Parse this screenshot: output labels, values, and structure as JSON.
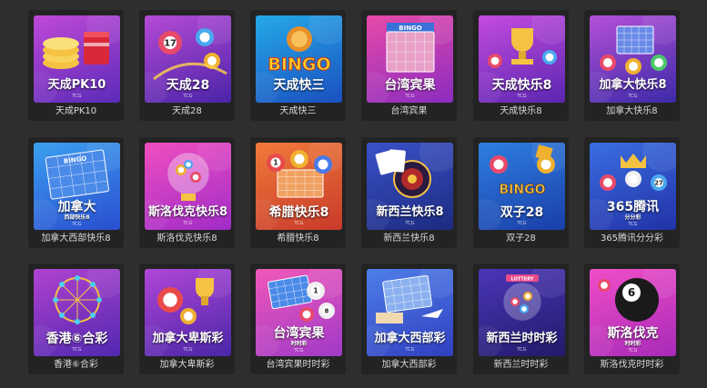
{
  "games": [
    {
      "label": "天成PK10",
      "thumb_title": "天成PK10",
      "thumb_sub": "",
      "thumb_tcg": "TCG",
      "bg_top": "#c048d8",
      "bg_bottom": "#5a2bb8",
      "art": "chips-coins-icon"
    },
    {
      "label": "天成28",
      "thumb_title": "天成28",
      "thumb_sub": "",
      "thumb_tcg": "TCG",
      "bg_top": "#b54ad6",
      "bg_bottom": "#4a24a8",
      "art": "lottery-balls-icon"
    },
    {
      "label": "天成快三",
      "thumb_title": "天成快三",
      "thumb_sub": "",
      "thumb_tcg": "",
      "bg_top": "#25a9e8",
      "bg_bottom": "#1a4fbf",
      "art": "bingo-lion-icon"
    },
    {
      "label": "台湾宾果",
      "thumb_title": "台湾宾果",
      "thumb_sub": "",
      "thumb_tcg": "TCG",
      "bg_top": "#e84aa8",
      "bg_bottom": "#8a2cc0",
      "art": "bingo-card-icon"
    },
    {
      "label": "天成快乐8",
      "thumb_title": "天成快乐8",
      "thumb_sub": "",
      "thumb_tcg": "TCG",
      "bg_top": "#c44be0",
      "bg_bottom": "#5a26b0",
      "art": "trophy-icon"
    },
    {
      "label": "加拿大快乐8",
      "thumb_title": "加拿大快乐8",
      "thumb_sub": "",
      "thumb_tcg": "TCG",
      "bg_top": "#b450d8",
      "bg_bottom": "#3c2aa8",
      "art": "balls-ticket-icon"
    },
    {
      "label": "加拿大西部快乐8",
      "thumb_title": "加拿大",
      "thumb_sub": "西部快乐8",
      "thumb_tcg": "TCG",
      "bg_top": "#3ba0f0",
      "bg_bottom": "#2a4ed0",
      "art": "bingo-ticket-icon"
    },
    {
      "label": "斯洛伐克快乐8",
      "thumb_title": "斯洛伐克快乐8",
      "thumb_sub": "",
      "thumb_tcg": "TCG",
      "bg_top": "#f04ec0",
      "bg_bottom": "#a02cc8",
      "art": "lottery-globe-icon"
    },
    {
      "label": "希腊快乐8",
      "thumb_title": "希腊快乐8",
      "thumb_sub": "",
      "thumb_tcg": "TCG",
      "bg_top": "#f07a3a",
      "bg_bottom": "#c83a2a",
      "art": "bingo-balls-icon"
    },
    {
      "label": "新西兰快乐8",
      "thumb_title": "新西兰快乐8",
      "thumb_sub": "",
      "thumb_tcg": "TCG",
      "bg_top": "#3a52c8",
      "bg_bottom": "#1c2a80",
      "art": "roulette-cards-icon"
    },
    {
      "label": "双子28",
      "thumb_title": "双子28",
      "thumb_sub": "",
      "thumb_tcg": "TCG",
      "bg_top": "#2e7fe0",
      "bg_bottom": "#1a3ea8",
      "art": "bingo-sign-icon"
    },
    {
      "label": "365腾讯分分彩",
      "thumb_title": "365腾讯",
      "thumb_sub": "分分彩",
      "thumb_tcg": "TCG",
      "bg_top": "#3a6ee0",
      "bg_bottom": "#2232a8",
      "art": "crown-balls-icon"
    },
    {
      "label": "香港⑥合彩",
      "thumb_title": "香港⑥合彩",
      "thumb_sub": "",
      "thumb_tcg": "TCG",
      "bg_top": "#b042d0",
      "bg_bottom": "#5028b0",
      "art": "ferris-wheel-icon"
    },
    {
      "label": "加拿大卑斯彩",
      "thumb_title": "加拿大卑斯彩",
      "thumb_sub": "",
      "thumb_tcg": "TCG",
      "bg_top": "#b046d8",
      "bg_bottom": "#4a26a8",
      "art": "trophy-balls-icon"
    },
    {
      "label": "台湾宾果时时彩",
      "thumb_title": "台湾宾果",
      "thumb_sub": "时时彩",
      "thumb_tcg": "TCG",
      "bg_top": "#f058b8",
      "bg_bottom": "#a03ac8",
      "art": "tickets-balls-icon"
    },
    {
      "label": "加拿大西部彩",
      "thumb_title": "加拿大西部彩",
      "thumb_sub": "",
      "thumb_tcg": "TCG",
      "bg_top": "#4e7ee8",
      "bg_bottom": "#3040c0",
      "art": "airplane-ticket-icon"
    },
    {
      "label": "新西兰时时彩",
      "thumb_title": "新西兰时时彩",
      "thumb_sub": "",
      "thumb_tcg": "TCG",
      "bg_top": "#4a36b8",
      "bg_bottom": "#221a6a",
      "art": "lottery-machine-icon"
    },
    {
      "label": "斯洛伐克时时彩",
      "thumb_title": "斯洛伐克",
      "thumb_sub": "时时彩",
      "thumb_tcg": "TCG",
      "bg_top": "#f04ec8",
      "bg_bottom": "#a82ab8",
      "art": "eight-ball-icon"
    }
  ]
}
